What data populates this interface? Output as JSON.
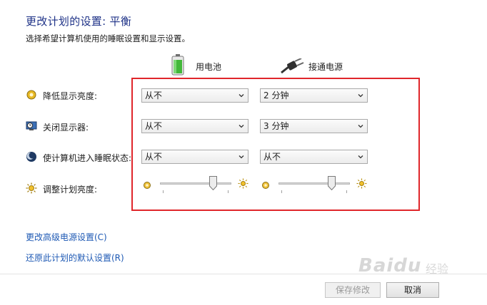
{
  "header": {
    "title": "更改计划的设置: 平衡",
    "subtitle": "选择希望计算机使用的睡眠设置和显示设置。"
  },
  "columns": {
    "battery": {
      "label": "用电池",
      "icon": "battery-icon"
    },
    "plugged": {
      "label": "接通电源",
      "icon": "power-plug-icon"
    }
  },
  "settings": [
    {
      "label": "降低显示亮度:",
      "icon": "dim-display-icon",
      "battery": "从不",
      "plugged": "2 分钟"
    },
    {
      "label": "关闭显示器:",
      "icon": "monitor-clock-icon",
      "battery": "从不",
      "plugged": "3 分钟"
    },
    {
      "label": "使计算机进入睡眠状态:",
      "icon": "sleep-moon-icon",
      "battery": "从不",
      "plugged": "从不"
    }
  ],
  "brightness": {
    "label": "调整计划亮度:",
    "icon": "brightness-icon",
    "battery_level": 0.78,
    "plugged_level": 0.78
  },
  "links": {
    "advanced": "更改高级电源设置(C)",
    "restore": "还原此计划的默认设置(R)"
  },
  "buttons": {
    "save": "保存修改",
    "cancel": "取消"
  },
  "watermark": {
    "main": "Baidu",
    "sub": "经验"
  },
  "colors": {
    "highlight_box": "#e0262b",
    "link": "#1e59b4",
    "title": "#1e3287"
  }
}
